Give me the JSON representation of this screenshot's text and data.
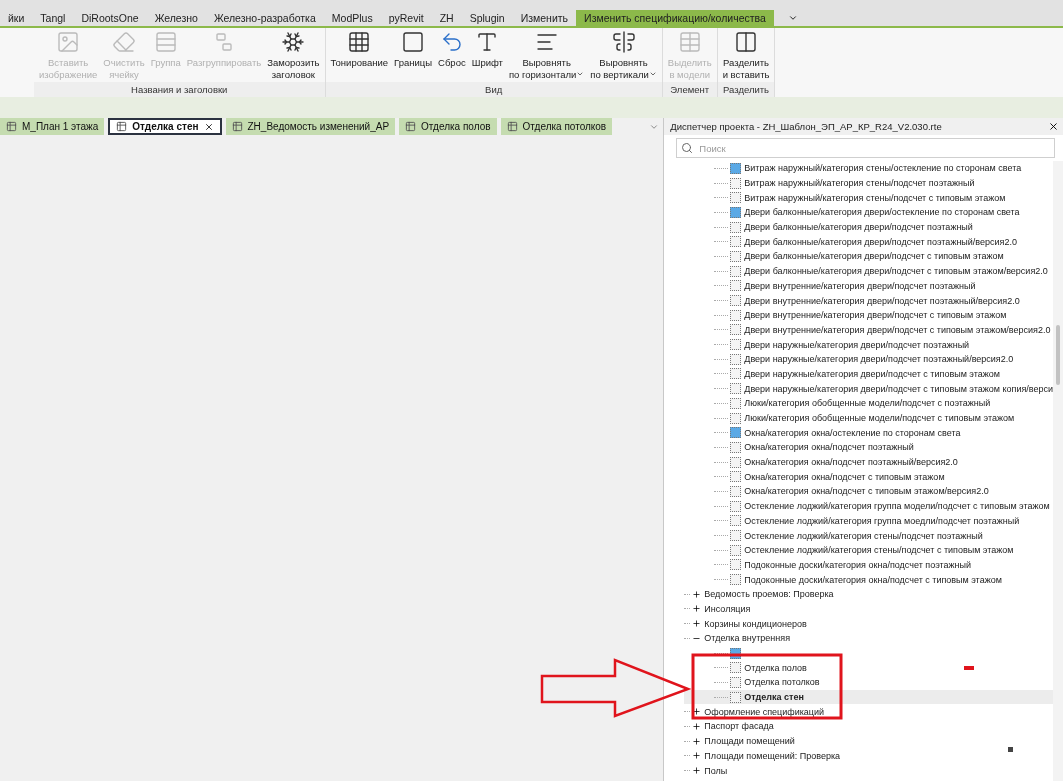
{
  "ribbon_tabs": [
    {
      "label": "йки",
      "selected": false
    },
    {
      "label": "Tangl",
      "selected": false
    },
    {
      "label": "DiRootsOne",
      "selected": false
    },
    {
      "label": "Железно",
      "selected": false
    },
    {
      "label": "Железно-разработка",
      "selected": false
    },
    {
      "label": "ModPlus",
      "selected": false
    },
    {
      "label": "pyRevit",
      "selected": false
    },
    {
      "label": "ZH",
      "selected": false
    },
    {
      "label": "Splugin",
      "selected": false
    },
    {
      "label": "Изменить",
      "selected": false
    },
    {
      "label": "Изменить спецификацию/количества",
      "selected": true
    }
  ],
  "ribbon_panels": [
    {
      "title": "Названия и заголовки",
      "buttons": [
        {
          "label": "Вставить\nизображение",
          "disabled": true,
          "dropdown": false
        },
        {
          "label": "Очистить\nячейку",
          "disabled": true,
          "dropdown": false
        },
        {
          "label": "Группа",
          "disabled": true,
          "dropdown": false
        },
        {
          "label": "Разгруппировать",
          "disabled": true,
          "dropdown": false
        },
        {
          "label": "Заморозить\nзаголовок",
          "disabled": false,
          "dropdown": false
        }
      ]
    },
    {
      "title": "Вид",
      "buttons": [
        {
          "label": "Тонирование",
          "disabled": false,
          "dropdown": false
        },
        {
          "label": "Границы",
          "disabled": false,
          "dropdown": false
        },
        {
          "label": "Сброс",
          "disabled": false,
          "dropdown": false
        },
        {
          "label": "Шрифт",
          "disabled": false,
          "dropdown": false
        },
        {
          "label": "Выровнять\nпо горизонтали",
          "disabled": false,
          "dropdown": true
        },
        {
          "label": "Выровнять\nпо вертикали",
          "disabled": false,
          "dropdown": true
        }
      ]
    },
    {
      "title": "Элемент",
      "buttons": [
        {
          "label": "Выделить\nв модели",
          "disabled": true,
          "dropdown": false
        }
      ]
    },
    {
      "title": "Разделить",
      "buttons": [
        {
          "label": "Разделить\nи вставить",
          "disabled": false,
          "dropdown": false
        }
      ]
    }
  ],
  "view_tabs": [
    {
      "label": "М_План 1 этажа",
      "selected": false
    },
    {
      "label": "Отделка стен",
      "selected": true
    },
    {
      "label": "ZH_Ведомость изменений_АР",
      "selected": false
    },
    {
      "label": "Отделка полов",
      "selected": false
    },
    {
      "label": "Отделка потолков",
      "selected": false
    }
  ],
  "project_browser": {
    "title": "Диспетчер проекта - ZH_Шаблон_ЭП_АР_КР_R24_V2.030.rte",
    "search": {
      "placeholder": "Поиск"
    },
    "items": [
      {
        "children": [
          {
            "label": "Витраж наружный/категория стены/остекление по сторонам света",
            "kind": "filled",
            "selected": false
          },
          {
            "label": "Витраж наружный/категория стены/подсчет поэтажный",
            "kind": "outline",
            "selected": false
          },
          {
            "label": "Витраж наружный/категория стены/подсчет с типовым этажом",
            "kind": "outline",
            "selected": false
          },
          {
            "label": "Двери балконные/категория двери/остекление по сторонам света",
            "kind": "filled",
            "selected": false
          },
          {
            "label": "Двери балконные/категория двери/подсчет поэтажный",
            "kind": "outline",
            "selected": false
          },
          {
            "label": "Двери балконные/категория двери/подсчет поэтажный/версия2.0",
            "kind": "outline",
            "selected": false
          },
          {
            "label": "Двери балконные/категория двери/подсчет с типовым этажом",
            "kind": "outline",
            "selected": false
          },
          {
            "label": "Двери балконные/категория двери/подсчет с типовым этажом/версия2.0",
            "kind": "outline",
            "selected": false
          },
          {
            "label": "Двери внутренние/категория двери/подсчет поэтажный",
            "kind": "outline",
            "selected": false
          },
          {
            "label": "Двери внутренние/категория двери/подсчет поэтажный/версия2.0",
            "kind": "outline",
            "selected": false
          },
          {
            "label": "Двери внутренние/категория двери/подсчет с типовым этажом",
            "kind": "outline",
            "selected": false
          },
          {
            "label": "Двери внутренние/категория двери/подсчет с типовым этажом/версия2.0",
            "kind": "outline",
            "selected": false
          },
          {
            "label": "Двери наружные/категория двери/подсчет поэтажный",
            "kind": "outline",
            "selected": false
          },
          {
            "label": "Двери наружные/категория двери/подсчет поэтажный/версия2.0",
            "kind": "outline",
            "selected": false
          },
          {
            "label": "Двери наружные/категория двери/подсчет с типовым этажом",
            "kind": "outline",
            "selected": false
          },
          {
            "label": "Двери наружные/категория двери/подсчет с типовым этажом копия/верси",
            "kind": "outline",
            "selected": false
          },
          {
            "label": "Люки/категория обобщенные модели/подсчет с поэтажный",
            "kind": "outline",
            "selected": false
          },
          {
            "label": "Люки/категория обобщенные модели/подсчет с типовым этажом",
            "kind": "outline",
            "selected": false
          },
          {
            "label": "Окна/категория окна/остекление по сторонам света",
            "kind": "filled",
            "selected": false
          },
          {
            "label": "Окна/категория окна/подсчет поэтажный",
            "kind": "outline",
            "selected": false
          },
          {
            "label": "Окна/категория окна/подсчет поэтажный/версия2.0",
            "kind": "outline",
            "selected": false
          },
          {
            "label": "Окна/категория окна/подсчет с типовым этажом",
            "kind": "outline",
            "selected": false
          },
          {
            "label": "Окна/категория окна/подсчет с типовым этажом/версия2.0",
            "kind": "outline",
            "selected": false
          },
          {
            "label": "Остекление лоджий/категория группа модели/подсчет с типовым этажом",
            "kind": "outline",
            "selected": false
          },
          {
            "label": "Остекление лоджий/категория группа моедли/подсчет поэтажный",
            "kind": "outline",
            "selected": false
          },
          {
            "label": "Остекление лоджий/категория стены/подсчет поэтажный",
            "kind": "outline",
            "selected": false
          },
          {
            "label": "Остекление лоджий/категория стены/подсчет с типовым этажом",
            "kind": "outline",
            "selected": false
          },
          {
            "label": "Подоконные доски/категория окна/подсчет поэтажный",
            "kind": "outline",
            "selected": false
          },
          {
            "label": "Подоконные доски/категория окна/подсчет с типовым этажом",
            "kind": "outline",
            "selected": false
          }
        ]
      },
      {
        "label": "Ведомость проемов: Проверка",
        "expanded": false
      },
      {
        "label": "Инсоляция",
        "expanded": false
      },
      {
        "label": "Корзины кондиционеров",
        "expanded": false
      },
      {
        "label": "Отделка внутренняя",
        "expanded": true,
        "children": [
          {
            "kind": "filled",
            "selected": false
          },
          {
            "label": "Отделка полов",
            "kind": "outline",
            "selected": false
          },
          {
            "label": "Отделка потолков",
            "kind": "outline",
            "selected": false
          },
          {
            "label": "Отделка стен",
            "kind": "outline",
            "selected": true
          }
        ]
      },
      {
        "label": "Оформление спецификаций",
        "expanded": false
      },
      {
        "label": "Паспорт фасада",
        "expanded": false
      },
      {
        "label": "Площади помещений",
        "expanded": false
      },
      {
        "label": "Площади помещений: Проверка",
        "expanded": false
      },
      {
        "label": "Полы",
        "expanded": false
      }
    ]
  }
}
